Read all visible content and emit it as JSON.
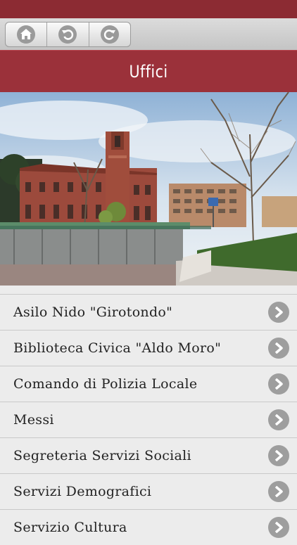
{
  "toolbar": {
    "buttons": [
      {
        "icon": "home-icon"
      },
      {
        "icon": "back-icon"
      },
      {
        "icon": "refresh-icon"
      }
    ]
  },
  "header": {
    "title": "Uffici"
  },
  "hero": {
    "image": "town-hall-photo"
  },
  "offices": {
    "items": [
      {
        "label": "Asilo Nido \"Girotondo\""
      },
      {
        "label": "Biblioteca Civica \"Aldo Moro\""
      },
      {
        "label": "Comando di Polizia Locale"
      },
      {
        "label": "Messi"
      },
      {
        "label": "Segreteria Servizi Sociali"
      },
      {
        "label": "Servizi Demografici"
      },
      {
        "label": "Servizio Cultura"
      }
    ]
  },
  "colors": {
    "brand": "#9b313a",
    "status_bar": "#8c2b33",
    "chevron": "#9e9e9e"
  }
}
